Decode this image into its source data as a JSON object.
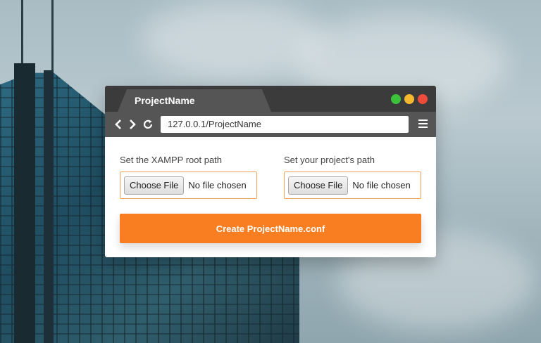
{
  "window": {
    "tab_title": "ProjectName",
    "url": "127.0.0.1/ProjectName",
    "controls": {
      "green": "#3cc13b",
      "yellow": "#f5b82e",
      "red": "#ee4b3b"
    }
  },
  "nav": {
    "back_icon": "chevron-left-icon",
    "forward_icon": "chevron-right-icon",
    "reload_icon": "reload-icon",
    "menu_icon": "hamburger-menu-icon"
  },
  "form": {
    "xampp_label": "Set the XAMPP root path",
    "project_label": "Set your project's path",
    "choose_file_label": "Choose File",
    "no_file_text": "No file chosen",
    "create_button": "Create ProjectName.conf"
  },
  "colors": {
    "accent": "#f97e22",
    "titlebar": "#3b3b3b",
    "toolbar": "#555555"
  }
}
